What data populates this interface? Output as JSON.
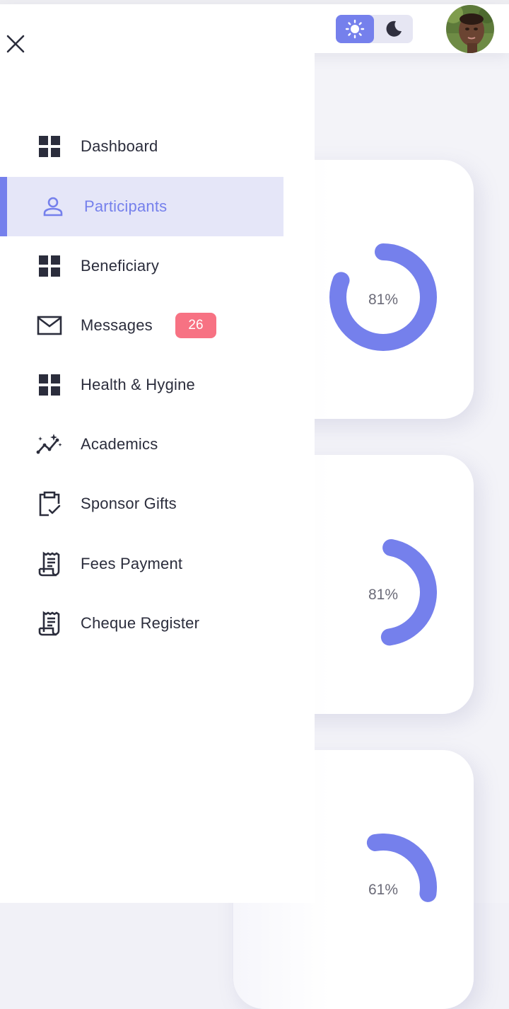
{
  "header": {
    "theme_light_icon": "sun-icon",
    "theme_dark_icon": "moon-icon",
    "avatar": "user-avatar-photo"
  },
  "cards": [
    {
      "percent_label": "81%",
      "progress": 0.81
    },
    {
      "percent_label": "81%",
      "progress": 0.45
    },
    {
      "percent_label": "61%",
      "progress": 0.3
    }
  ],
  "drawer": {
    "close_icon": "close-icon",
    "items": [
      {
        "label": "Dashboard",
        "icon": "grid-icon"
      },
      {
        "label": "Participants",
        "icon": "person-icon",
        "active": true
      },
      {
        "label": "Beneficiary",
        "icon": "grid-icon"
      },
      {
        "label": "Messages",
        "icon": "mail-icon",
        "badge": "26"
      },
      {
        "label": "Health & Hygine",
        "icon": "grid-icon"
      },
      {
        "label": "Academics",
        "icon": "sparkle-chart-icon"
      },
      {
        "label": "Sponsor Gifts",
        "icon": "clipboard-check-icon"
      },
      {
        "label": "Fees Payment",
        "icon": "receipt-icon"
      },
      {
        "label": "Cheque Register",
        "icon": "receipt-icon"
      }
    ]
  },
  "colors": {
    "accent": "#7580ec",
    "badge": "#f77283",
    "active_bg": "#e5e6f8",
    "text": "#2b2d3c"
  }
}
